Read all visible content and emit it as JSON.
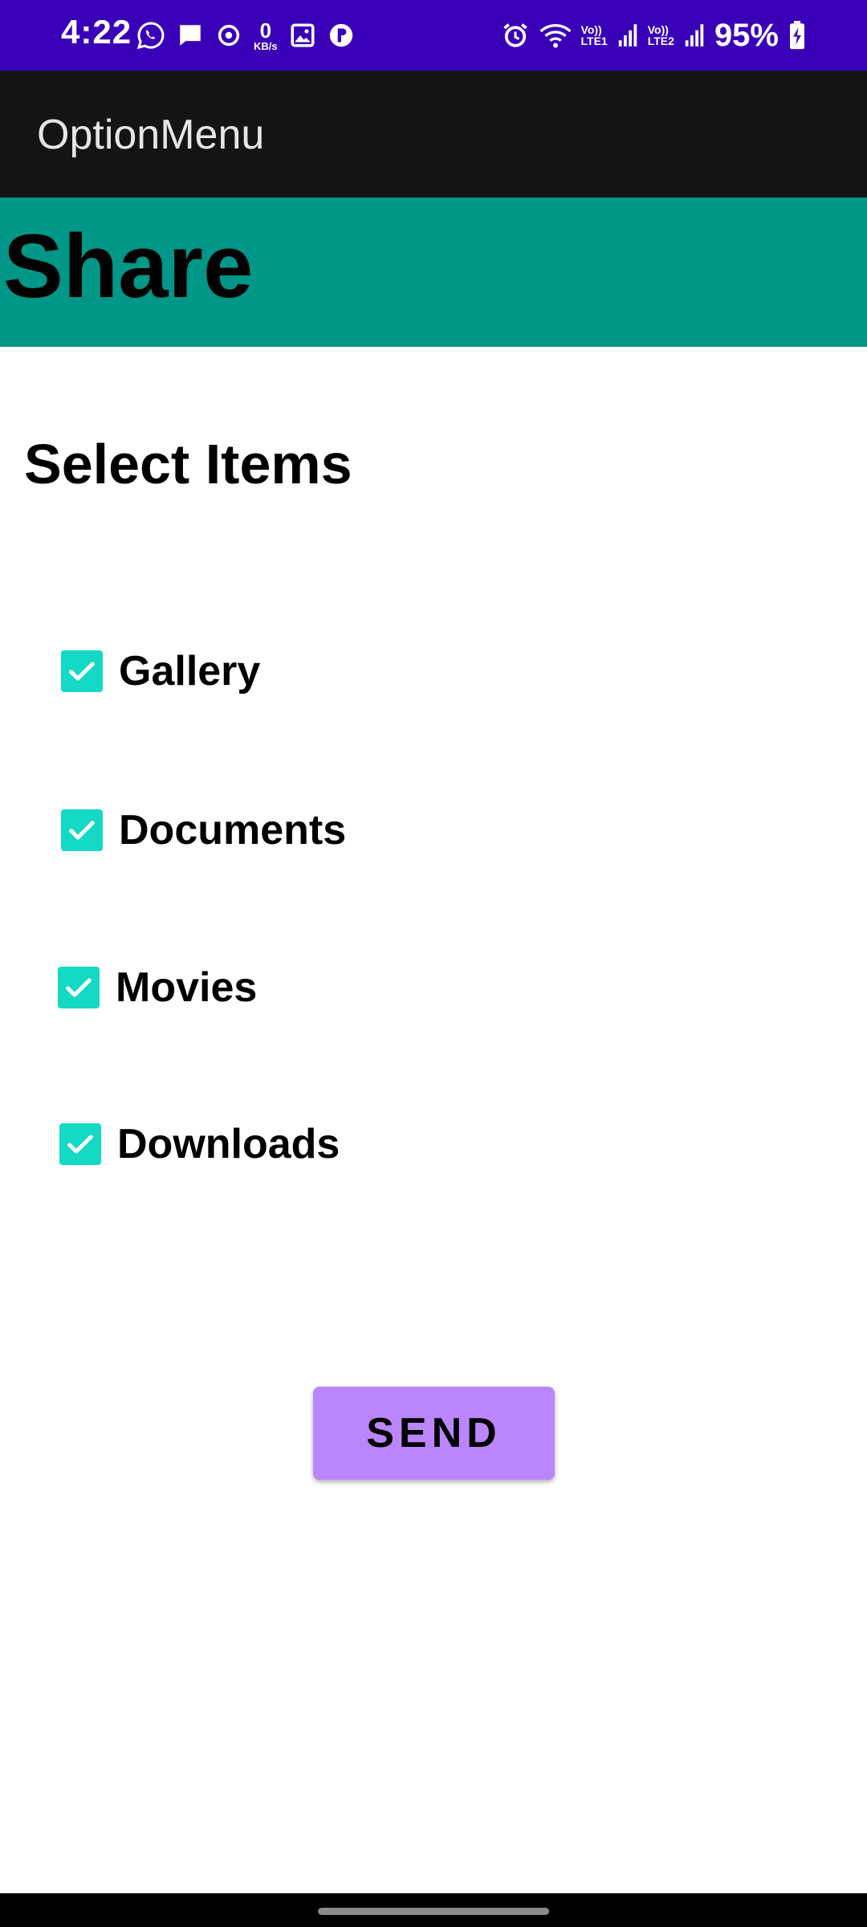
{
  "status_bar": {
    "time": "4:22",
    "net_speed_value": "0",
    "net_speed_unit": "KB/s",
    "sim1_top": "Vo))",
    "sim1_bottom": "LTE1",
    "sim2_top": "Vo))",
    "sim2_bottom": "LTE2",
    "battery": "95%",
    "background_color": "#3a00b8"
  },
  "app_bar": {
    "title": "OptionMenu"
  },
  "banner": {
    "title": "Share",
    "color": "#009688"
  },
  "content": {
    "section_title": "Select Items",
    "items": [
      {
        "label": "Gallery",
        "checked": true
      },
      {
        "label": "Documents",
        "checked": true
      },
      {
        "label": "Movies",
        "checked": true
      },
      {
        "label": "Downloads",
        "checked": true
      }
    ],
    "checkbox_color": "#14d9c4"
  },
  "send_button": {
    "label": "SEND",
    "color": "#bb86fc"
  }
}
